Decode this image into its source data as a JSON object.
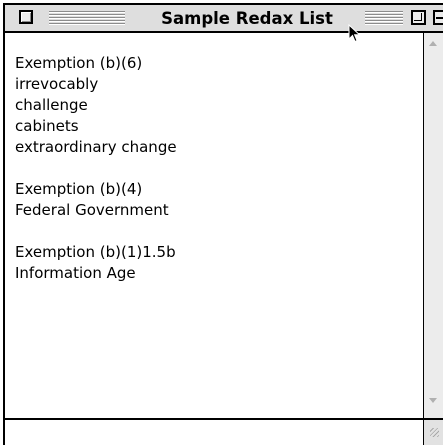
{
  "window": {
    "title": "Sample Redax List"
  },
  "list": {
    "items": [
      "Exemption (b)(6)",
      "irrevocably",
      "challenge",
      "cabinets",
      "extraordinary change",
      "",
      "Exemption (b)(4)",
      "Federal Government",
      "",
      "Exemption (b)(1)1.5b",
      "Information Age"
    ]
  },
  "icons": {
    "close": "close-box-icon",
    "zoom": "zoom-box-icon",
    "collapse": "collapse-box-icon",
    "scroll_up": "arrow-up-icon",
    "scroll_down": "arrow-down-icon",
    "grow": "resize-grip-icon",
    "pointer": "arrow-cursor-icon"
  }
}
